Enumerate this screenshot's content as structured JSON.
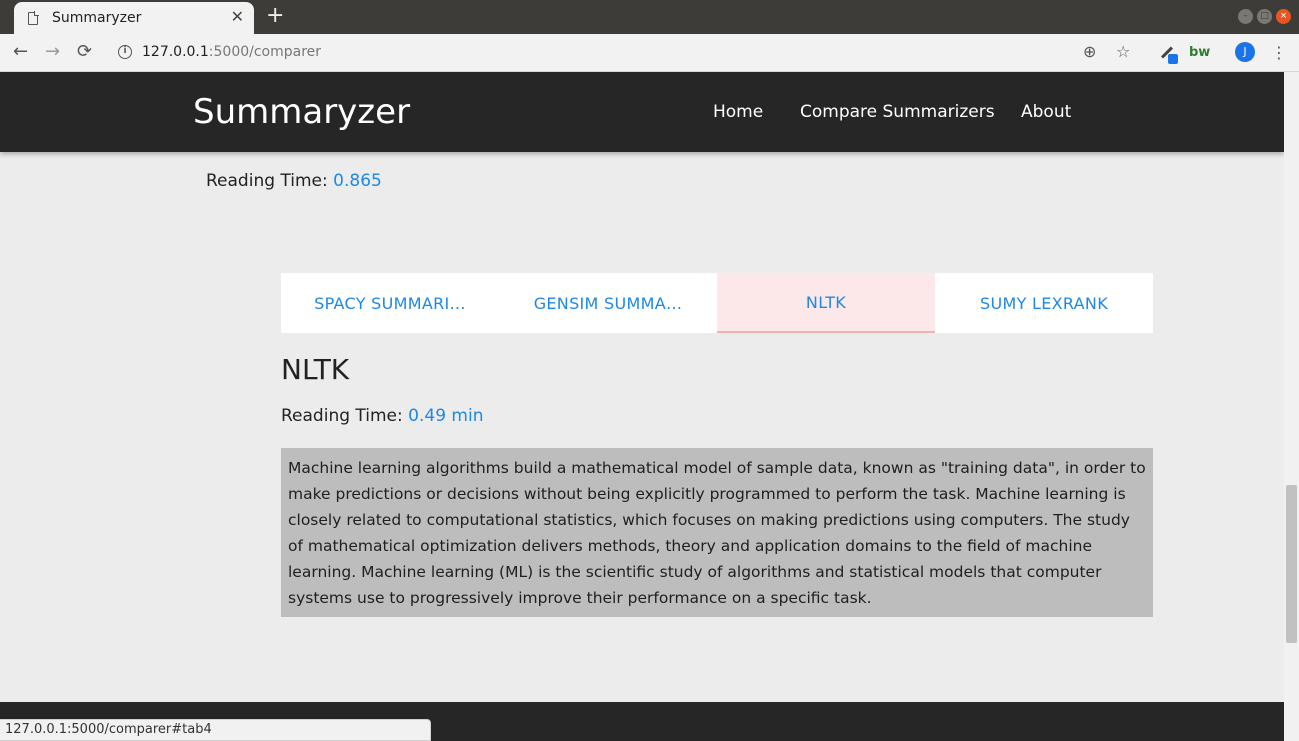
{
  "browser": {
    "tab_title": "Summaryzer",
    "tab_close": "✕",
    "new_tab": "+",
    "url_host": "127.0.0.1",
    "url_path": ":5000/comparer",
    "back": "←",
    "forward": "→",
    "reload": "⟳",
    "info": "i",
    "zoom": "⊕",
    "star": "☆",
    "ext_bw": "bw",
    "avatar": "J",
    "menu": "⋮",
    "status_url": "127.0.0.1:5000/comparer#tab4"
  },
  "navbar": {
    "brand": "Summaryzer",
    "links": [
      "Home",
      "Compare Summarizers",
      "About"
    ]
  },
  "top_reading": {
    "label": "Reading Time: ",
    "value": "0.865"
  },
  "tabs": [
    {
      "label": "SPACY SUMMARI…",
      "active": false
    },
    {
      "label": "GENSIM SUMMA…",
      "active": false
    },
    {
      "label": "NLTK",
      "active": true
    },
    {
      "label": "SUMY LEXRANK",
      "active": false
    }
  ],
  "section": {
    "title": "NLTK",
    "reading_label": "Reading Time: ",
    "reading_value": "0.49 min",
    "summary": "Machine learning algorithms build a mathematical model of sample data, known as \"training data\", in order to make predictions or decisions without being explicitly programmed to perform the task. Machine learning is closely related to computational statistics, which focuses on making predictions using computers. The study of mathematical optimization delivers methods, theory and application domains to the field of machine learning. Machine learning (ML) is the scientific study of algorithms and statistical models that computer systems use to progressively improve their performance on a specific task."
  },
  "colors": {
    "navbar_bg": "#262626",
    "accent": "#1e88e5",
    "active_tab_bg": "#fce8e8",
    "summary_bg": "#bdbdbd"
  }
}
